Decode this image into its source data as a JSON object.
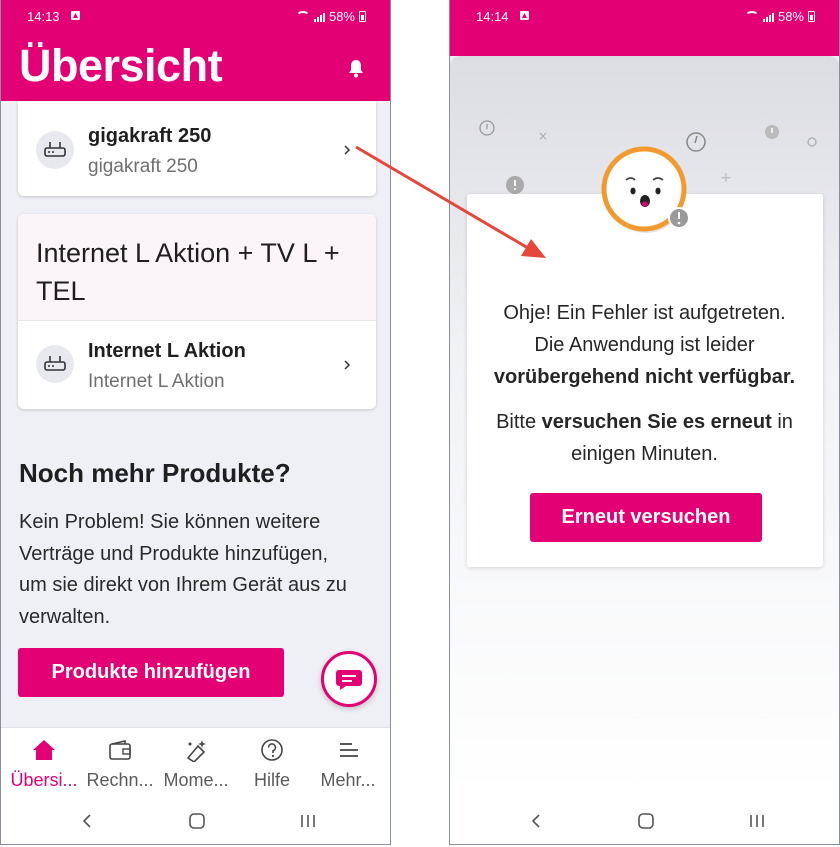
{
  "left": {
    "status": {
      "time": "14:13",
      "battery": "58%"
    },
    "header": {
      "title": "Übersicht"
    },
    "product1": {
      "title": "gigakraft 250",
      "subtitle": "gigakraft 250"
    },
    "group2": {
      "heading": "Internet L Aktion + TV L + TEL",
      "item": {
        "title": "Internet L Aktion",
        "subtitle": "Internet L Aktion"
      }
    },
    "more": {
      "heading": "Noch mehr Produkte?",
      "text": "Kein Problem! Sie können weitere Verträge und Produkte hinzufügen, um sie direkt von Ihrem Gerät aus zu verwalten.",
      "button": "Produkte hinzufügen"
    },
    "nav": [
      {
        "label": "Übersi...",
        "icon": "home-icon"
      },
      {
        "label": "Rechn...",
        "icon": "wallet-icon"
      },
      {
        "label": "Mome...",
        "icon": "sparkle-icon"
      },
      {
        "label": "Hilfe",
        "icon": "help-icon"
      },
      {
        "label": "Mehr...",
        "icon": "menu-icon"
      }
    ]
  },
  "right": {
    "status": {
      "time": "14:14",
      "battery": "58%"
    },
    "error": {
      "line1": "Ohje! Ein Fehler ist aufgetreten.",
      "line2": "Die Anwendung ist leider",
      "line3": "vorübergehend nicht verfügbar.",
      "retry_prefix": "Bitte ",
      "retry_bold": "versuchen Sie es erneut",
      "retry_suffix": " in",
      "retry_line2": "einigen Minuten.",
      "button": "Erneut versuchen"
    }
  },
  "colors": {
    "brand": "#e20074",
    "arrow": "#e8463a"
  }
}
